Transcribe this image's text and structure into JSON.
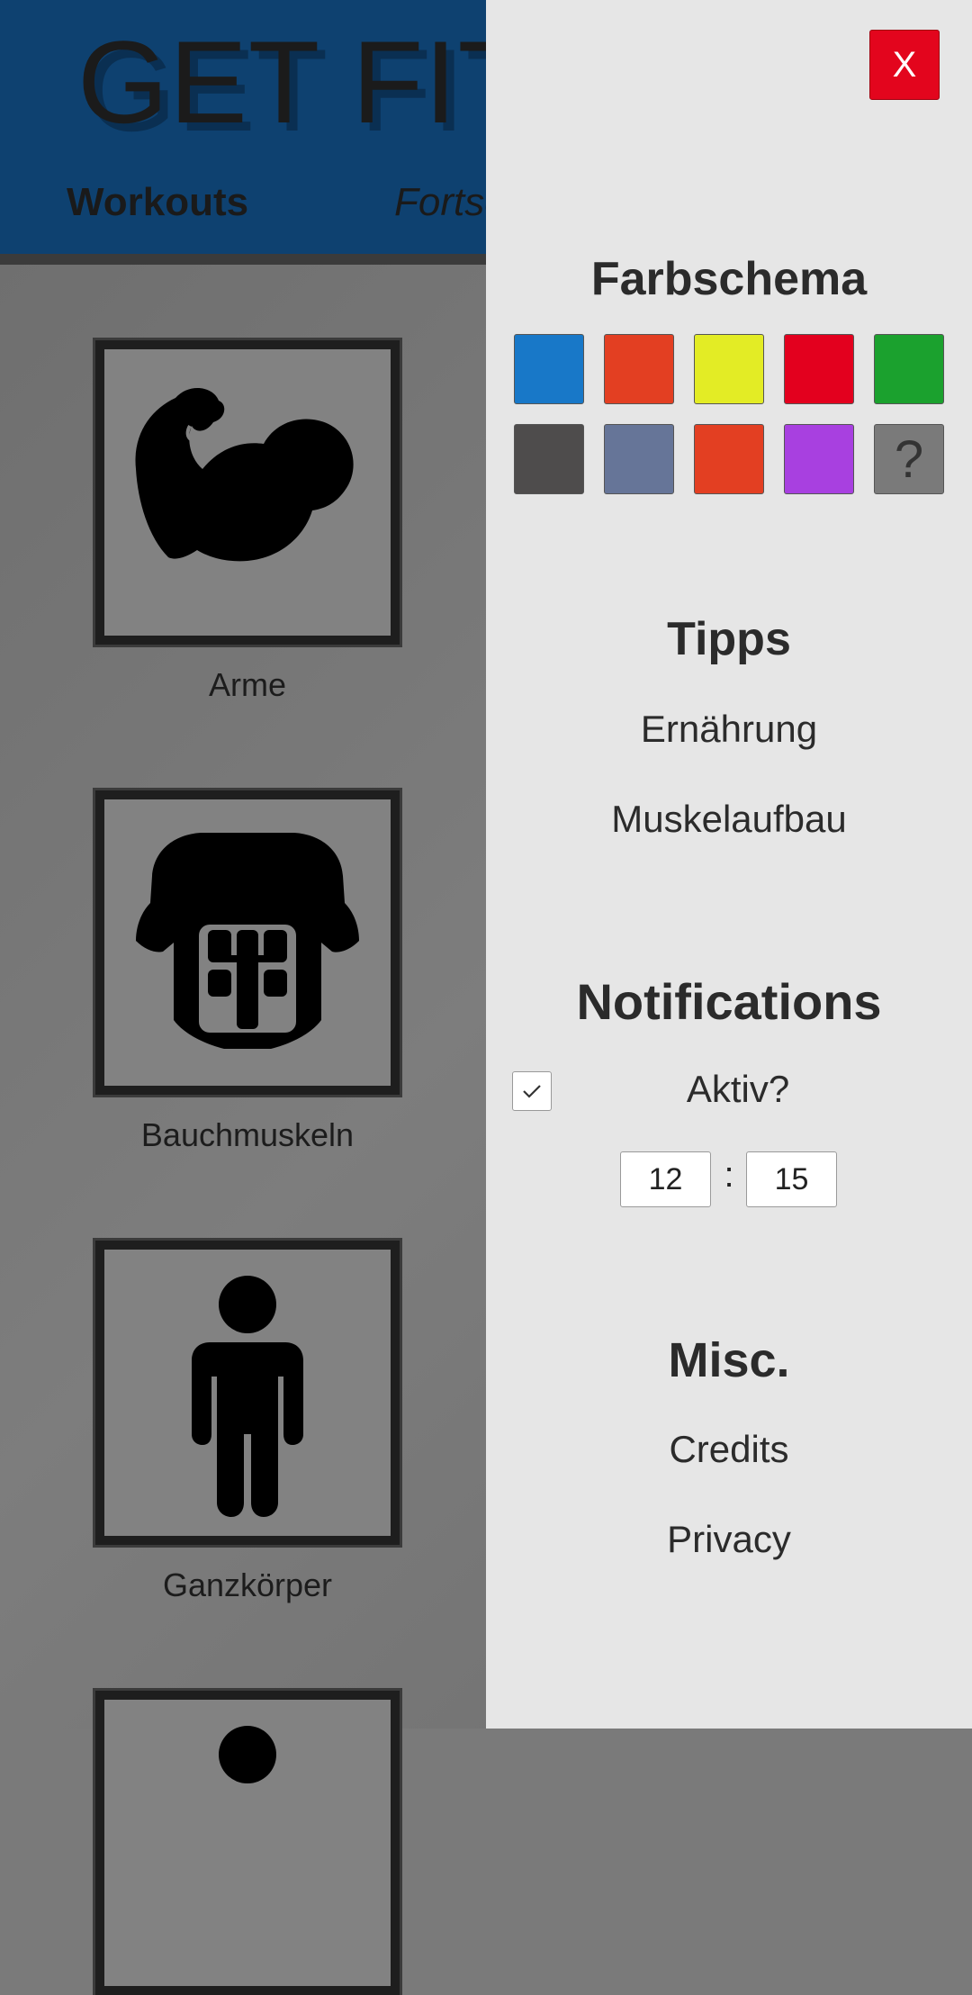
{
  "app": {
    "title": "GET FIT",
    "tabs": [
      {
        "label": "Workouts"
      },
      {
        "label": "Fortschritt"
      }
    ],
    "workouts": [
      {
        "label": "Arme",
        "icon": "biceps-icon"
      },
      {
        "label": "Bauchmuskeln",
        "icon": "torso-abs-icon"
      },
      {
        "label": "Ganzkörper",
        "icon": "person-icon"
      },
      {
        "label": "",
        "icon": "partial-icon"
      }
    ]
  },
  "panel": {
    "close_label": "X",
    "color_scheme": {
      "title": "Farbschema",
      "colors": [
        "#1878c8",
        "#e33f22",
        "#e3ec25",
        "#e3001e",
        "#1ba12e",
        "#4e4c4c",
        "#667598",
        "#e33f22",
        "#a840e0",
        "#7a7a7a"
      ],
      "random_label": "?"
    },
    "tips": {
      "title": "Tipps",
      "items": [
        "Ernährung",
        "Muskelaufbau"
      ]
    },
    "notifications": {
      "title": "Notifications",
      "active_label": "Aktiv?",
      "active": true,
      "hour": "12",
      "minute": "15",
      "separator": ":"
    },
    "misc": {
      "title": "Misc.",
      "items": [
        "Credits",
        "Privacy"
      ]
    }
  }
}
